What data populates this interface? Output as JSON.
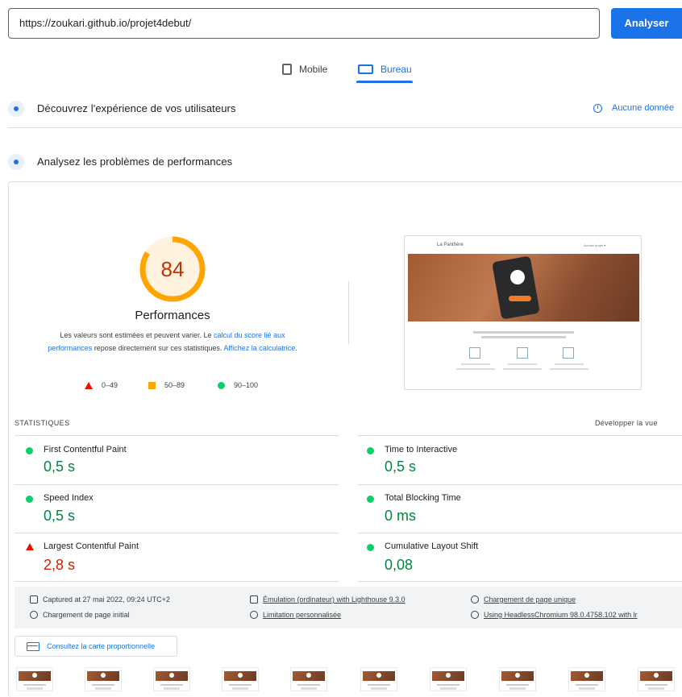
{
  "search": {
    "url": "https://zoukari.github.io/projet4debut/",
    "analyze_label": "Analyser"
  },
  "device_tabs": {
    "mobile": "Mobile",
    "desktop": "Bureau",
    "active": "desktop"
  },
  "field_data": {
    "title": "Découvrez l'expérience de vos utilisateurs",
    "no_data": "Aucune donnée"
  },
  "lab": {
    "title": "Analysez les problèmes de performances",
    "score": "84",
    "score_fraction": 0.84,
    "score_color": "#ffa400",
    "category": "Performances",
    "desc_1": "Les valeurs sont estimées et peuvent varier. Le ",
    "desc_link_1": "calcul du score lié aux performances",
    "desc_2": " repose directement sur ces statistiques. ",
    "desc_link_2": "Affichez la calculatrice",
    "desc_3": ".",
    "legend": {
      "fail": "0–49",
      "average": "50–89",
      "pass": "90–100"
    },
    "preview": {
      "logo": "La Panthère",
      "menu": "Accueil  projet ▾"
    }
  },
  "stats": {
    "header": "STATISTIQUES",
    "expand": "Développer la vue",
    "metrics": [
      {
        "name": "First Contentful Paint",
        "value": "0,5 s",
        "status": "pass"
      },
      {
        "name": "Time to Interactive",
        "value": "0,5 s",
        "status": "pass"
      },
      {
        "name": "Speed Index",
        "value": "0,5 s",
        "status": "pass"
      },
      {
        "name": "Total Blocking Time",
        "value": "0 ms",
        "status": "pass"
      },
      {
        "name": "Largest Contentful Paint",
        "value": "2,8 s",
        "status": "fail"
      },
      {
        "name": "Cumulative Layout Shift",
        "value": "0,08",
        "status": "pass"
      }
    ]
  },
  "runtime": {
    "captured": "Captured at 27 mai 2022, 09:24 UTC+2",
    "initial_load": "Chargement de page initial",
    "emulation": "Émulation (ordinateur) with Lighthouse 9.3.0",
    "throttling": "Limitation personnalisée",
    "single_load": "Chargement de page unique",
    "browser": "Using HeadlessChromium 98.0.4758.102 with lr"
  },
  "treemap_label": "Consultez la carte proportionnelle",
  "colors": {
    "accent": "#1a73e8",
    "pass": "#0cce6b",
    "average": "#ffa400",
    "fail": "#eb0f00"
  }
}
